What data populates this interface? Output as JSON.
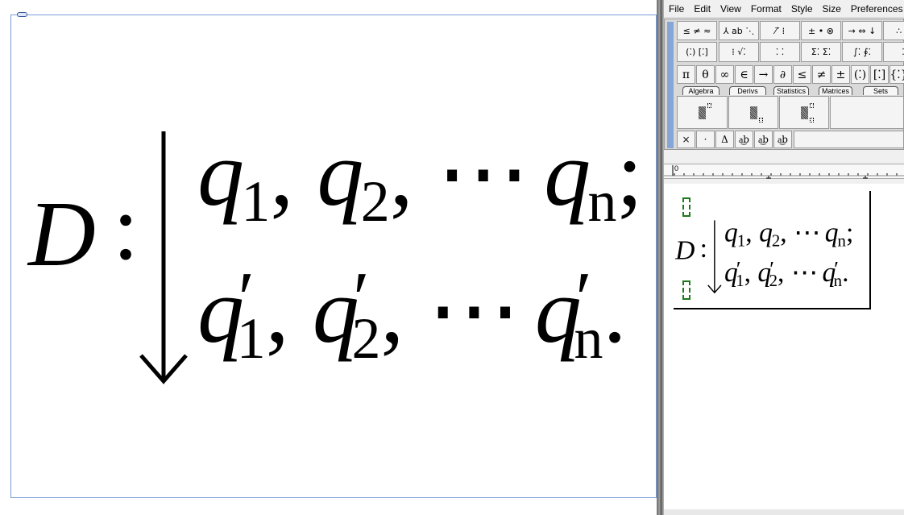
{
  "equation": {
    "lhs": "D",
    "colon": ":",
    "rows": [
      {
        "terms": [
          {
            "base": "q",
            "sub": "1",
            "prime": "",
            "sep": ","
          },
          {
            "base": "q",
            "sub": "2",
            "prime": "",
            "sep": ","
          },
          {
            "ellipsis": "⋯"
          },
          {
            "base": "q",
            "sub": "n",
            "prime": "",
            "sep": ";"
          }
        ]
      },
      {
        "terms": [
          {
            "base": "q",
            "sub": "1",
            "prime": "′",
            "sep": ","
          },
          {
            "base": "q",
            "sub": "2",
            "prime": "′",
            "sep": ","
          },
          {
            "ellipsis": "⋯"
          },
          {
            "base": "q",
            "sub": "n",
            "prime": "′",
            "sep": "."
          }
        ]
      }
    ]
  },
  "menu": [
    "File",
    "Edit",
    "View",
    "Format",
    "Style",
    "Size",
    "Preferences"
  ],
  "toolbar": {
    "row1": [
      "≤ ≠ ≈",
      "⅄ ab ⋱",
      "⁄ ⃗ ⁞",
      "± • ⊗",
      "→ ⇔ ↓",
      "∴ ∵"
    ],
    "row2": [
      "(⁚) [⁚]",
      "⁞ √⁚",
      "⁚ ⁚",
      "Σ⁚ Σ⁚",
      "∫⁚ ∮⁚",
      "⁚"
    ],
    "row3": [
      "π",
      "θ",
      "∞",
      "∈",
      "→",
      "∂",
      "≤",
      "≠",
      "±",
      "(⁚)",
      "[⁚]",
      "{⁚}"
    ],
    "tabs": [
      "Algebra",
      "Derivs",
      "Statistics",
      "Matrices",
      "Sets"
    ],
    "row5": [
      "×",
      "·",
      "Δ",
      "a͜b",
      "a͜b",
      "a͜b"
    ],
    "nudge": [
      "⮤",
      "↑",
      "↥",
      "↑̲",
      "↑."
    ],
    "ruler_label": "0"
  }
}
